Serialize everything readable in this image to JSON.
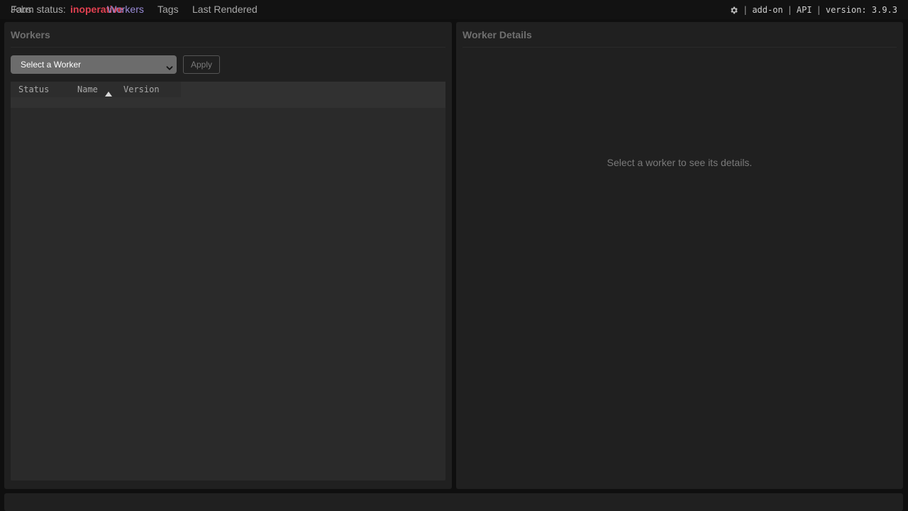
{
  "topbar": {
    "farm_label": "Farm status:",
    "farm_status": "inoperative",
    "nav": {
      "jobs": "Jobs",
      "workers": "Workers",
      "tags": "Tags",
      "last_rendered": "Last Rendered"
    },
    "right": {
      "icon": "gear-icon",
      "sep": "|",
      "addon": "add-on",
      "api": "API",
      "version": "version: 3.9.3"
    }
  },
  "workers_panel": {
    "title": "Workers",
    "select_value": "Select a Worker",
    "apply_label": "Apply",
    "table": {
      "columns": [
        "Status",
        "Name",
        "Version"
      ],
      "sort_column": "Name",
      "sort_direction": "ascending",
      "rows": []
    }
  },
  "details_panel": {
    "title": "Worker Details",
    "placeholder": "Select a worker to see its details."
  },
  "colors": {
    "accent": "#9a8cd8",
    "status_error": "#e04050",
    "background": "#0f0f0f",
    "panel": "#202020"
  }
}
